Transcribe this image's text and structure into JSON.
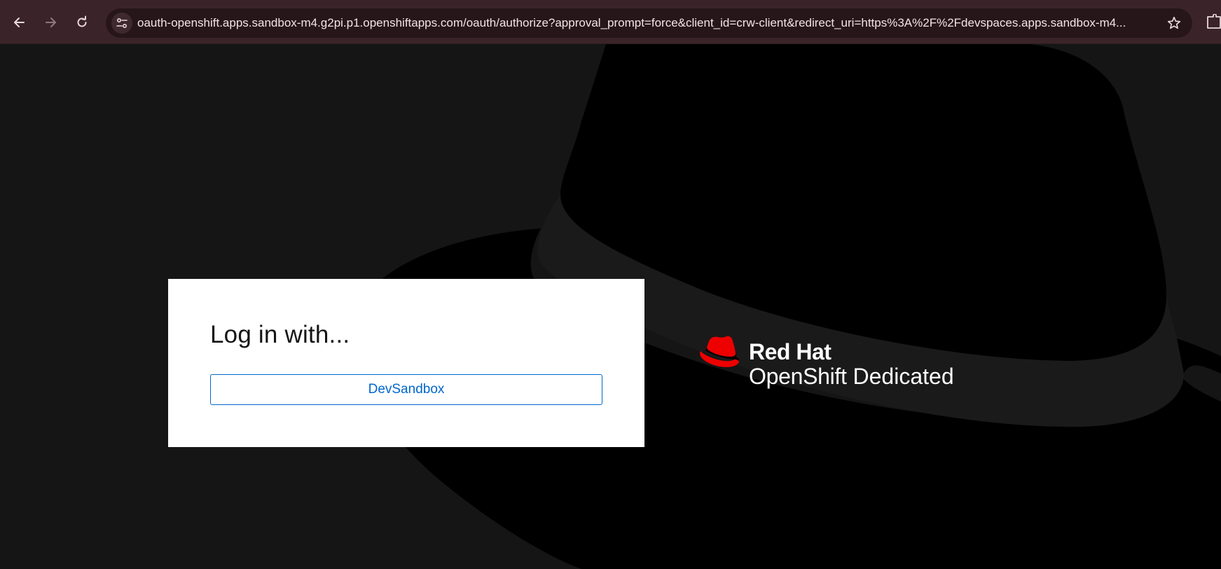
{
  "browser": {
    "url": "oauth-openshift.apps.sandbox-m4.g2pi.p1.openshiftapps.com/oauth/authorize?approval_prompt=force&client_id=crw-client&redirect_uri=https%3A%2F%2Fdevspaces.apps.sandbox-m4...",
    "icons": [
      "back-arrow-icon",
      "forward-arrow-icon",
      "reload-icon",
      "site-settings-icon",
      "bookmark-star-icon",
      "extensions-icon"
    ]
  },
  "login": {
    "title": "Log in with...",
    "providers": [
      {
        "label": "DevSandbox"
      }
    ]
  },
  "brand": {
    "company": "Red Hat",
    "product": "OpenShift",
    "edition": "Dedicated",
    "logo_icon": "red-hat-fedora-icon",
    "logo_color": "#ee0000"
  },
  "colors": {
    "browser_bar": "#3b2429",
    "omnibox": "#271619",
    "page_background": "#151515",
    "hat_shape": "#000000",
    "link_blue": "#0066cc"
  }
}
